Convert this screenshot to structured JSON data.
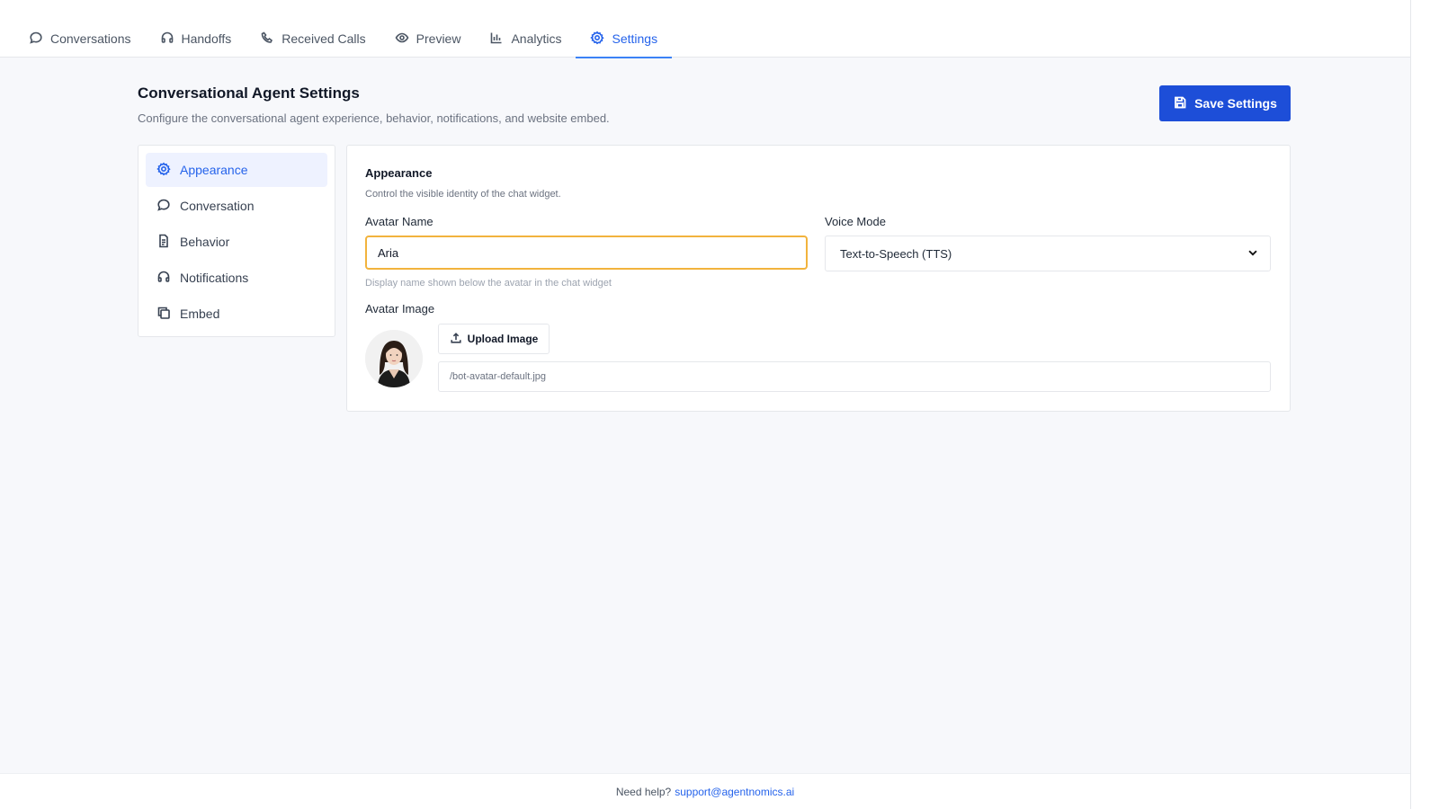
{
  "tabs": [
    {
      "label": "Conversations",
      "icon": "chat-bubble-icon"
    },
    {
      "label": "Handoffs",
      "icon": "headphones-icon"
    },
    {
      "label": "Received Calls",
      "icon": "phone-icon"
    },
    {
      "label": "Preview",
      "icon": "eye-icon"
    },
    {
      "label": "Analytics",
      "icon": "bar-chart-icon"
    },
    {
      "label": "Settings",
      "icon": "gear-icon",
      "active": true
    }
  ],
  "header": {
    "title": "Conversational Agent Settings",
    "subtitle": "Configure the conversational agent experience, behavior, notifications, and website embed.",
    "save_label": "Save Settings"
  },
  "sidenav": {
    "items": [
      {
        "label": "Appearance",
        "icon": "gear-icon",
        "active": true
      },
      {
        "label": "Conversation",
        "icon": "chat-bubble-icon"
      },
      {
        "label": "Behavior",
        "icon": "document-icon"
      },
      {
        "label": "Notifications",
        "icon": "headphones-icon"
      },
      {
        "label": "Embed",
        "icon": "copy-icon"
      }
    ]
  },
  "appearance": {
    "title": "Appearance",
    "subtitle": "Control the visible identity of the chat widget.",
    "avatar_name_label": "Avatar Name",
    "avatar_name_value": "Aria",
    "avatar_name_helper": "Display name shown below the avatar in the chat widget",
    "voice_mode_label": "Voice Mode",
    "voice_mode_value": "Text-to-Speech (TTS)",
    "avatar_image_label": "Avatar Image",
    "upload_label": "Upload Image",
    "avatar_path": "/bot-avatar-default.jpg"
  },
  "footer": {
    "help_text": "Need help?",
    "email": "support@agentnomics.ai"
  },
  "colors": {
    "accent": "#2563eb",
    "primary_button": "#1d4ed8",
    "focus_border": "#f2b33d",
    "background": "#f7f8fb"
  }
}
